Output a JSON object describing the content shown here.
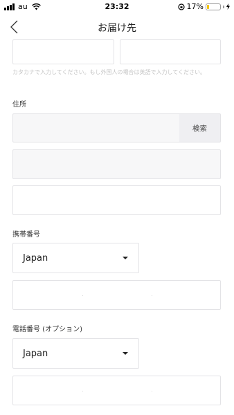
{
  "status_bar": {
    "carrier": "au",
    "time": "23:32",
    "battery_percent": "17%",
    "battery_level": 0.17,
    "battery_color": "#f5c400"
  },
  "nav": {
    "title": "お届け先",
    "back_icon": "chevron-left-icon"
  },
  "name_fields": {
    "first_value": "",
    "second_value": ""
  },
  "helper_text": "カタカナで入力してください。もし外国人の場合は英語で入力してください。",
  "address": {
    "label": "住所",
    "search_label": "検索",
    "postal_value": "",
    "line1_value": "",
    "line2_value": ""
  },
  "mobile": {
    "label": "携帯番号",
    "country": "Japan",
    "number_value": ""
  },
  "phone": {
    "label": "電話番号 (オプション)",
    "country": "Japan",
    "number_value": ""
  },
  "colors": {
    "border": "#e3e3e6",
    "helper": "#c4c4c4",
    "search_bg": "#efeff2"
  }
}
